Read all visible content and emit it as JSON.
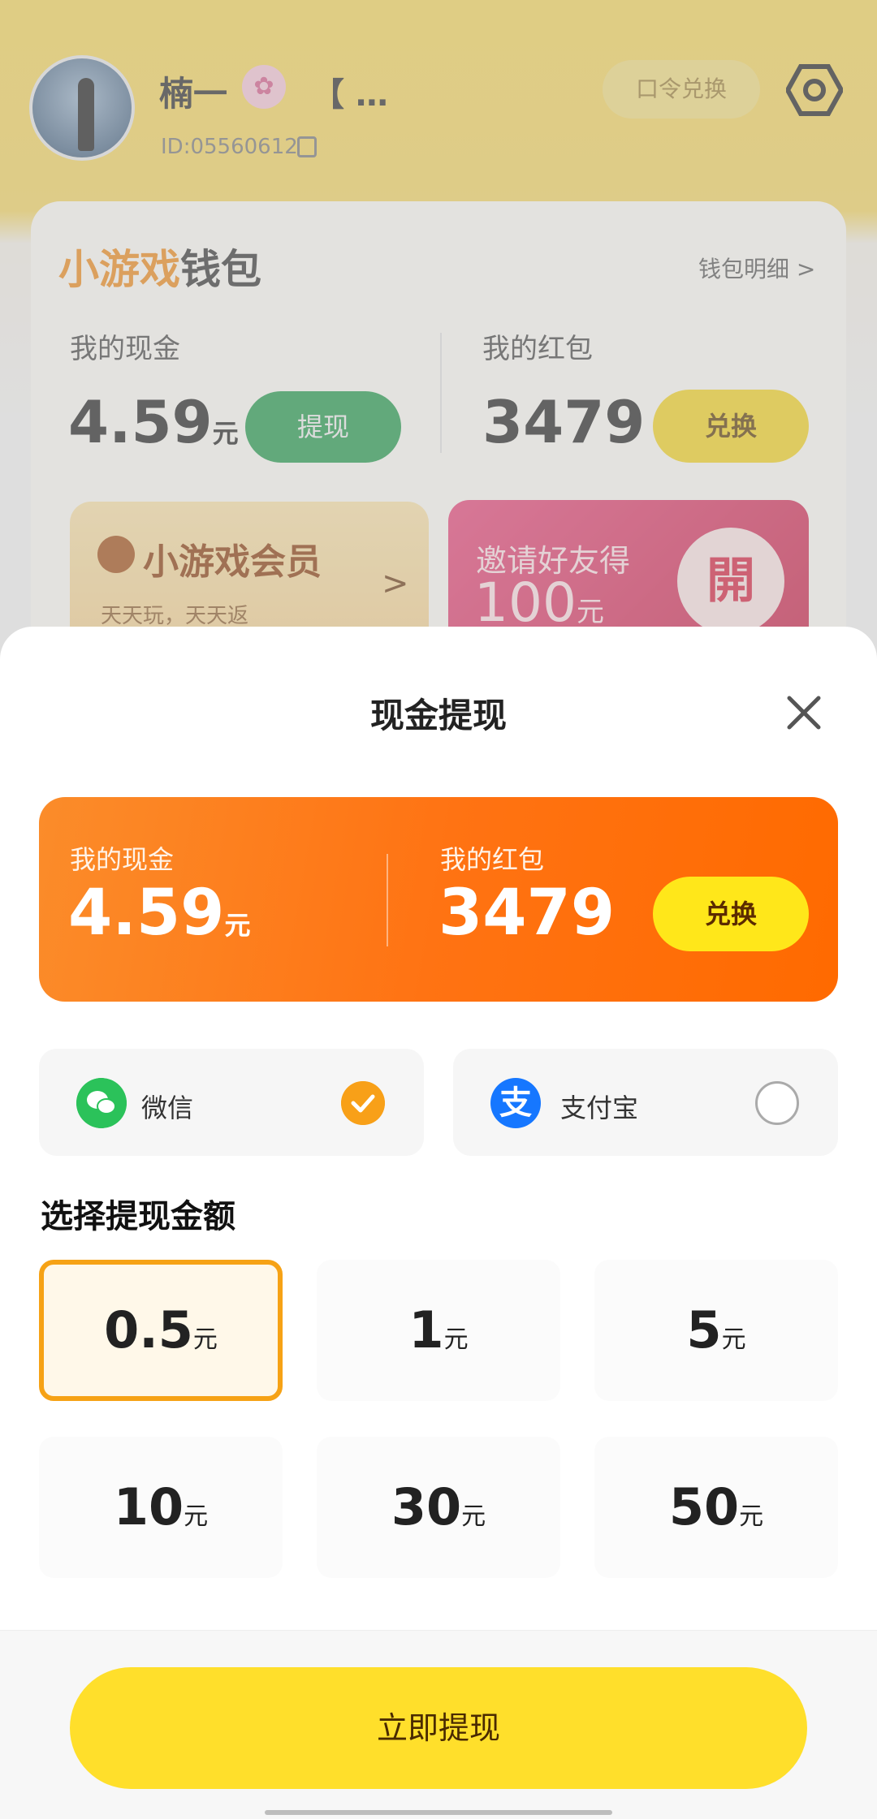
{
  "profile": {
    "name": "楠一",
    "name_rest": "【 …",
    "id_text": "ID:05560612",
    "redeem_label": "口令兑换"
  },
  "wallet": {
    "title_highlight": "小游戏",
    "title_rest": "钱包",
    "detail_link": "钱包明细 >",
    "cash_label": "我的现金",
    "cash_value": "4.59",
    "cash_unit": "元",
    "withdraw_btn": "提现",
    "redpack_label": "我的红包",
    "redpack_value": "3479",
    "exchange_btn": "兑换"
  },
  "promo": {
    "vip_title": "小游戏会员",
    "vip_sub": "天天玩，天天返",
    "vip_arrow": ">",
    "invite_text": "邀请好友得",
    "invite_amount": "100",
    "invite_unit": "元",
    "open_badge": "開"
  },
  "sheet": {
    "title": "现金提现",
    "card": {
      "cash_label": "我的现金",
      "cash_value": "4.59",
      "cash_unit": "元",
      "redpack_label": "我的红包",
      "redpack_value": "3479",
      "exchange_btn": "兑换"
    },
    "payment": [
      {
        "name": "微信",
        "selected": true
      },
      {
        "name": "支付宝",
        "selected": false
      }
    ],
    "alipay_glyph": "支",
    "amount_title": "选择提现金额",
    "amounts": [
      {
        "value": "0.5",
        "unit": "元"
      },
      {
        "value": "1",
        "unit": "元"
      },
      {
        "value": "5",
        "unit": "元"
      },
      {
        "value": "10",
        "unit": "元"
      },
      {
        "value": "30",
        "unit": "元"
      },
      {
        "value": "50",
        "unit": "元"
      }
    ],
    "selected_amount": "0.5",
    "cta": "立即提现"
  },
  "colors": {
    "accent_orange": "#ff7313",
    "cta_yellow": "#ffdf2b",
    "select_border": "#f6a215",
    "wechat_green": "#2bc25a",
    "alipay_blue": "#1677ff"
  }
}
